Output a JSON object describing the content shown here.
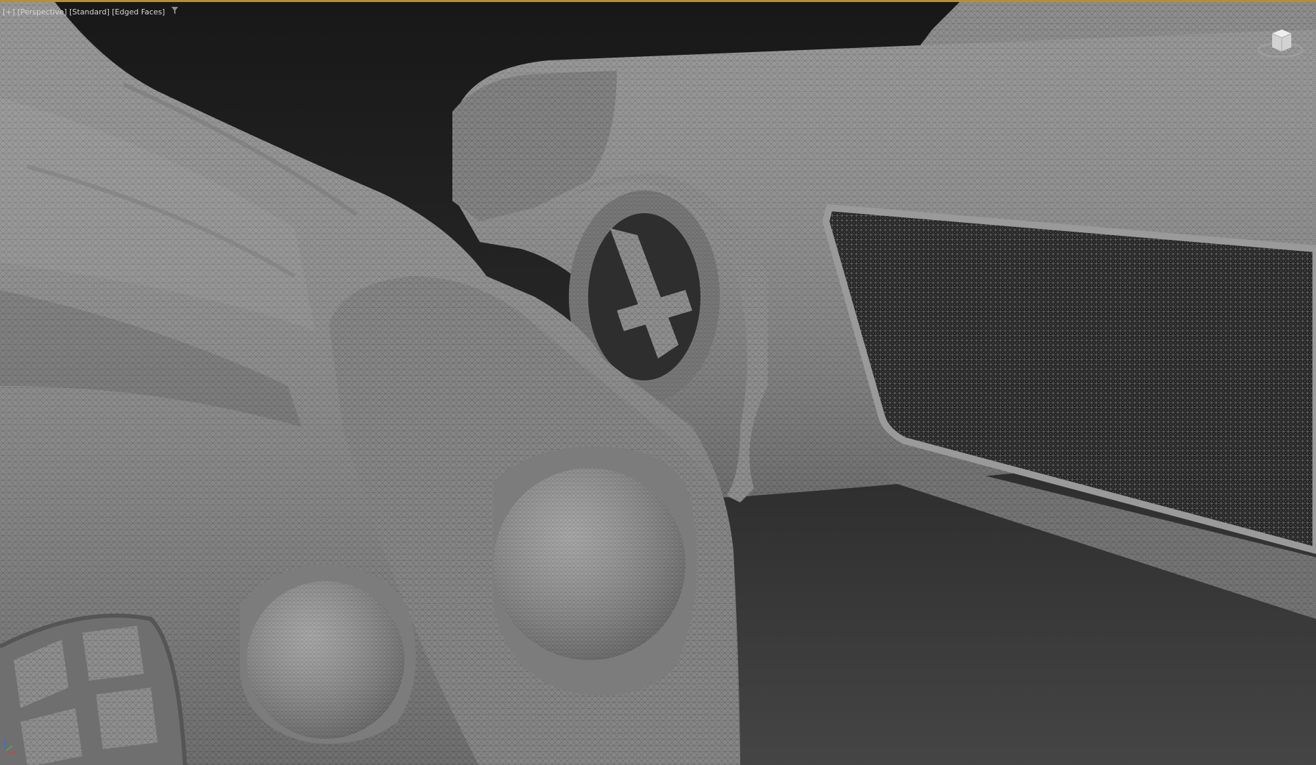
{
  "viewport": {
    "label_plus": "[+]",
    "label_view": "[Perspective]",
    "label_shading": "[Standard]",
    "label_style": "[Edged Faces]",
    "filter_icon": "funnel-icon",
    "viewcube_icon": "viewcube-icon",
    "axis_icon": "axis-tripod-icon"
  },
  "colors": {
    "accent_border": "#b8902e",
    "background_top": "#1c1c1c",
    "background_bottom": "#3a3a3a",
    "model_base": "#8e8e8e",
    "wire": "#6a6a6a"
  }
}
